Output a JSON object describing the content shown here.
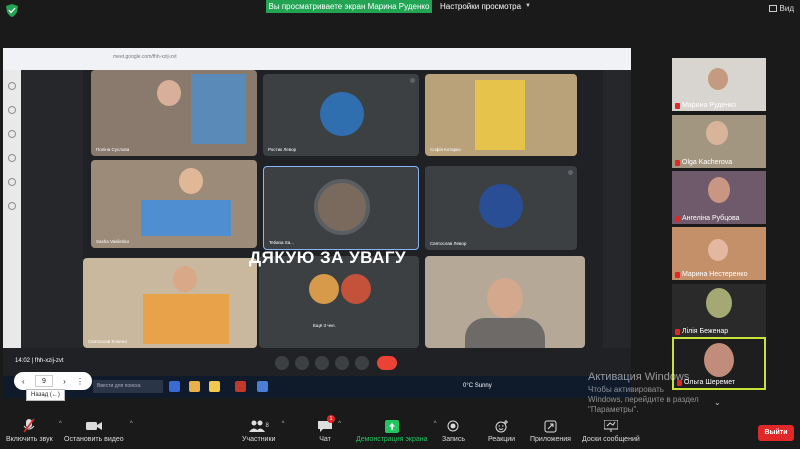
{
  "top": {
    "share_banner": "Вы просматриваете экран Марина Руденко",
    "view_settings": "Настройки просмотра",
    "view_label": "Вид"
  },
  "shared": {
    "url": "meet.google.com/fhh-xzij-zvt",
    "thanks_text": "ДЯКУЮ ЗА УВАГУ",
    "tiles": [
      {
        "name": "Поліна Суслова"
      },
      {
        "name": "Ростик Левор"
      },
      {
        "name": "Софія Котарко"
      },
      {
        "name": "Sasha Vasilenko"
      },
      {
        "name": "Tetiana Sa..."
      },
      {
        "name": "Святослав Левор"
      },
      {
        "name": "Святослав Ключко"
      },
      {
        "name": "Ещё 3 чел."
      },
      {
        "name": ""
      }
    ],
    "meeting_time": "14:02",
    "meeting_code": "fhh-xzij-zvt",
    "taskbar_search": "Ввести для поиска",
    "weather": "0°C Sunny"
  },
  "pager": {
    "current": "9",
    "back_tooltip": "Назад (←)"
  },
  "participants": [
    {
      "name": "Марина Руденко"
    },
    {
      "name": "Olga Kacherova"
    },
    {
      "name": "Ангеліна Рубцова"
    },
    {
      "name": "Марина Нестеренко"
    },
    {
      "name": "Лілія Беженар"
    },
    {
      "name": "Ольга Шеремет"
    }
  ],
  "watermark": {
    "title": "Активация Windows",
    "subtitle": "Чтобы активировать Windows, перейдите в раздел \"Параметры\"."
  },
  "toolbar": {
    "audio": "Включить звук",
    "video": "Остановить видео",
    "participants": "Участники",
    "participants_count": "8",
    "chat": "Чат",
    "chat_badge": "1",
    "share": "Демонстрация экрана",
    "record": "Запись",
    "reactions": "Реакции",
    "apps": "Приложения",
    "whiteboards": "Доски сообщений",
    "exit": "Выйти"
  },
  "colors": {
    "share_green": "#23a455",
    "exit_red": "#e02828",
    "active_border": "#c8e23a"
  }
}
